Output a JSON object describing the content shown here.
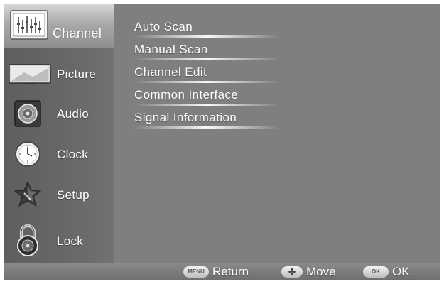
{
  "sidebar": {
    "items": [
      {
        "label": "Channel",
        "icon": "channel-icon",
        "active": true
      },
      {
        "label": "Picture",
        "icon": "picture-icon",
        "active": false
      },
      {
        "label": "Audio",
        "icon": "audio-icon",
        "active": false
      },
      {
        "label": "Clock",
        "icon": "clock-icon",
        "active": false
      },
      {
        "label": "Setup",
        "icon": "setup-icon",
        "active": false
      },
      {
        "label": "Lock",
        "icon": "lock-icon",
        "active": false
      }
    ]
  },
  "menu": {
    "items": [
      {
        "label": "Auto Scan"
      },
      {
        "label": "Manual Scan"
      },
      {
        "label": "Channel Edit"
      },
      {
        "label": "Common Interface"
      },
      {
        "label": "Signal Information"
      }
    ]
  },
  "footer": {
    "return": {
      "key": "MENU",
      "label": "Return"
    },
    "move": {
      "key": "✣",
      "label": "Move"
    },
    "ok": {
      "key": "OK",
      "label": "OK"
    }
  },
  "colors": {
    "screen_bg": "#7e7e7e",
    "sidebar_bg": "#666666",
    "active_tab": "#b5b5b5",
    "text": "#ffffff"
  }
}
